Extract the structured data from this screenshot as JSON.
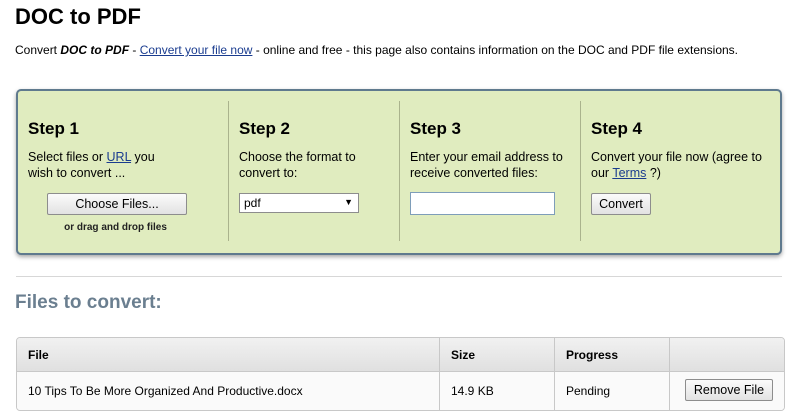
{
  "header": {
    "title": "DOC to PDF"
  },
  "intro": {
    "prefix": "Convert ",
    "emphasis": "DOC to PDF",
    "dash": " - ",
    "link": "Convert your file now",
    "suffix": " - online and free - this page also contains information on the DOC and PDF file extensions."
  },
  "steps": [
    {
      "title": "Step 1",
      "desc_before": "Select files or ",
      "desc_link": "URL",
      "desc_after": " you wish to convert ...",
      "button": "Choose Files...",
      "hint": "or drag and drop files"
    },
    {
      "title": "Step 2",
      "desc": "Choose the format to convert to:",
      "select_value": "pdf"
    },
    {
      "title": "Step 3",
      "desc": "Enter your email address to receive converted files:",
      "email_value": ""
    },
    {
      "title": "Step 4",
      "desc_before": "Convert your file now (agree to our ",
      "desc_link": "Terms",
      "desc_after": " ?)",
      "button": "Convert"
    }
  ],
  "files": {
    "title": "Files to convert:",
    "columns": [
      "File",
      "Size",
      "Progress",
      ""
    ],
    "rows": [
      {
        "file": "10 Tips To Be More Organized And Productive.docx",
        "size": "14.9 KB",
        "progress": "Pending",
        "action": "Remove File"
      }
    ]
  },
  "colors": {
    "panel_bg": "#e0ecbf",
    "panel_border": "#5f7a8e",
    "link": "#1a3c8f",
    "section_title": "#6b7f90"
  }
}
